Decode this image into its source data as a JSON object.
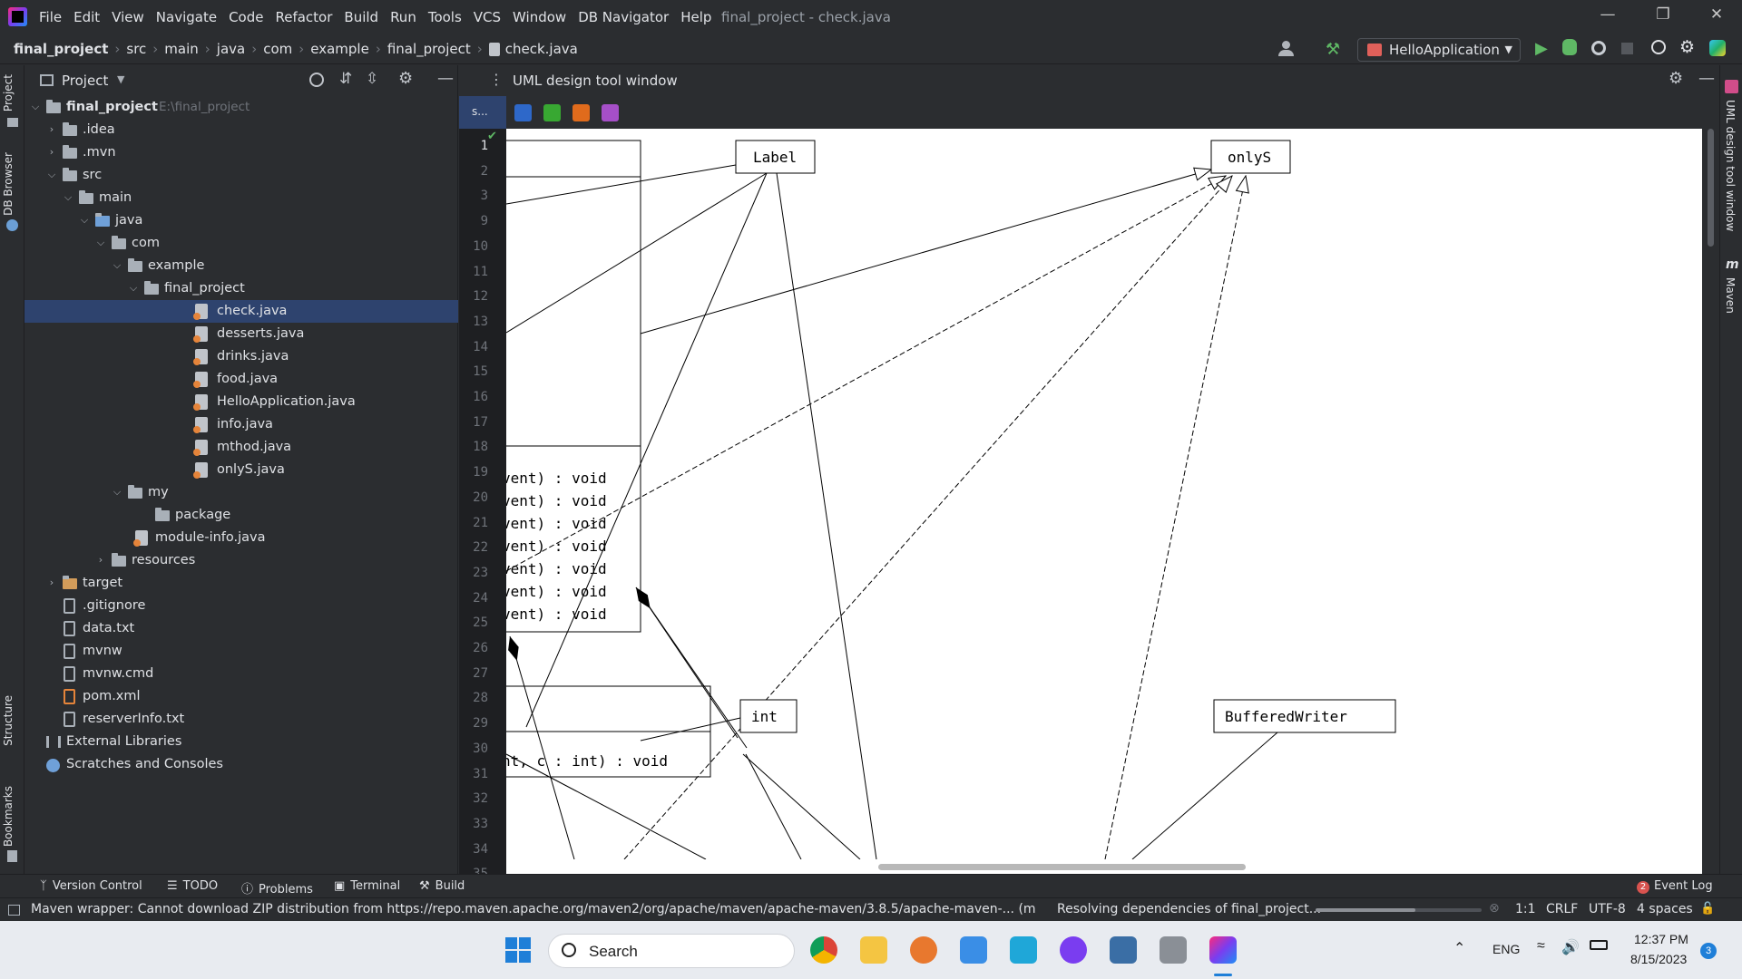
{
  "window": {
    "title": "final_project - check.java",
    "menu": [
      "File",
      "Edit",
      "View",
      "Navigate",
      "Code",
      "Refactor",
      "Build",
      "Run",
      "Tools",
      "VCS",
      "Window",
      "DB Navigator",
      "Help"
    ]
  },
  "breadcrumb": [
    "final_project",
    "src",
    "main",
    "java",
    "com",
    "example",
    "final_project",
    "check.java"
  ],
  "run_config": "HelloApplication",
  "left_stripe": {
    "project": "Project",
    "db_browser": "DB Browser",
    "structure": "Structure",
    "bookmarks": "Bookmarks"
  },
  "project_panel": {
    "title": "Project",
    "tree": {
      "root_name": "final_project",
      "root_path": "E:\\final_project",
      "idea": ".idea",
      "mvn": ".mvn",
      "src": "src",
      "main": "main",
      "java": "java",
      "com": "com",
      "example": "example",
      "final_project": "final_project",
      "files": [
        "check.java",
        "desserts.java",
        "drinks.java",
        "food.java",
        "HelloApplication.java",
        "info.java",
        "mthod.java",
        "onlyS.java"
      ],
      "my": "my",
      "package": "package",
      "module_info": "module-info.java",
      "resources": "resources",
      "target": "target",
      "gitignore": ".gitignore",
      "data_txt": "data.txt",
      "mvnw": "mvnw",
      "mvnw_cmd": "mvnw.cmd",
      "pom": "pom.xml",
      "reserver": "reserverInfo.txt",
      "external": "External Libraries",
      "scratches": "Scratches and Consoles"
    }
  },
  "editor": {
    "tab": "s...",
    "line_numbers": [
      "1",
      "2",
      "3",
      "9",
      "10",
      "11",
      "12",
      "13",
      "14",
      "15",
      "16",
      "17",
      "18",
      "19",
      "20",
      "21",
      "22",
      "23",
      "24",
      "25",
      "26",
      "27",
      "28",
      "29",
      "30",
      "31",
      "32",
      "33",
      "34",
      "35"
    ]
  },
  "uml": {
    "title": "UML design tool window",
    "classes": {
      "label": "Label",
      "onlys": "onlyS",
      "int": "int",
      "buffered_writer": "BufferedWriter"
    },
    "methods": [
      "vent) : void",
      "vent) : void",
      "vent) : void",
      "vent) : void",
      "vent) : void",
      "vent) : void",
      "vent) : void"
    ],
    "bottom_method": "nt, c : int) : void"
  },
  "right_stripe": {
    "uml": "UML design tool window",
    "maven": "Maven"
  },
  "bottom_tools": [
    "Version Control",
    "TODO",
    "Problems",
    "Terminal",
    "Build"
  ],
  "event_log": {
    "count": "2",
    "label": "Event Log"
  },
  "status": {
    "message": "Maven wrapper: Cannot download ZIP distribution from https://repo.maven.apache.org/maven2/org/apache/maven/apache-maven/3.8.5/apache-maven-... (moments a",
    "progress_label": "Resolving dependencies of final_project...",
    "position": "1:1",
    "line_sep": "CRLF",
    "encoding": "UTF-8",
    "indent": "4 spaces"
  },
  "taskbar": {
    "search": "Search",
    "lang": "ENG",
    "time": "12:37 PM",
    "date": "8/15/2023",
    "notif": "3"
  }
}
